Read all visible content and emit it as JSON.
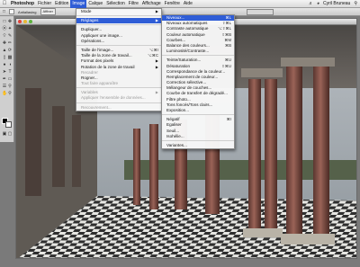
{
  "menubar": {
    "apple": "",
    "items": [
      "Photoshop",
      "Fichier",
      "Edition",
      "Image",
      "Calque",
      "Sélection",
      "Filtre",
      "Affichage",
      "Fenêtre",
      "Aide"
    ],
    "active_index": 3,
    "right_user": "Cyril Bruneau"
  },
  "optbar": {
    "checkbox_label": "Antialiasing",
    "button_label": "Affiner"
  },
  "image_menu": [
    {
      "label": "Mode",
      "sc": "",
      "sub": true,
      "dis": false,
      "sep_after": true
    },
    {
      "label": "Réglages",
      "sc": "",
      "sub": true,
      "dis": false,
      "hl": true,
      "sep_after": true
    },
    {
      "label": "Dupliquer...",
      "sc": "",
      "dis": false
    },
    {
      "label": "Appliquer une image...",
      "sc": "",
      "dis": false
    },
    {
      "label": "Opérations...",
      "sc": "",
      "dis": false,
      "sep_after": true
    },
    {
      "label": "Taille de l'image...",
      "sc": "⌥⌘I",
      "dis": false
    },
    {
      "label": "Taille de la zone de travail...",
      "sc": "⌥⌘C",
      "dis": false
    },
    {
      "label": "Format des pixels",
      "sc": "",
      "sub": true,
      "dis": false
    },
    {
      "label": "Rotation de la zone de travail",
      "sc": "",
      "sub": true,
      "dis": false
    },
    {
      "label": "Recadrer",
      "sc": "",
      "dis": true
    },
    {
      "label": "Rogner...",
      "sc": "",
      "dis": false
    },
    {
      "label": "Tout faire apparaître",
      "sc": "",
      "dis": true,
      "sep_after": true
    },
    {
      "label": "Variables",
      "sc": "",
      "sub": true,
      "dis": true
    },
    {
      "label": "Appliquer l'ensemble de données...",
      "sc": "",
      "dis": true,
      "sep_after": true
    },
    {
      "label": "Recouvrement...",
      "sc": "",
      "dis": true
    }
  ],
  "adjust_menu": [
    {
      "label": "Niveaux...",
      "sc": "⌘L",
      "hl": true
    },
    {
      "label": "Niveaux automatiques",
      "sc": "⇧⌘L"
    },
    {
      "label": "Contraste automatique",
      "sc": "⌥⇧⌘L"
    },
    {
      "label": "Couleur automatique",
      "sc": "⇧⌘B"
    },
    {
      "label": "Courbes...",
      "sc": "⌘M"
    },
    {
      "label": "Balance des couleurs...",
      "sc": "⌘B"
    },
    {
      "label": "Luminosité/Contraste...",
      "sc": "",
      "sep_after": true
    },
    {
      "label": "Teinte/Saturation...",
      "sc": "⌘U"
    },
    {
      "label": "Désaturation",
      "sc": "⇧⌘U"
    },
    {
      "label": "Correspondance de la couleur...",
      "sc": ""
    },
    {
      "label": "Remplacement de couleur...",
      "sc": ""
    },
    {
      "label": "Correction sélective...",
      "sc": ""
    },
    {
      "label": "Mélangeur de couches...",
      "sc": ""
    },
    {
      "label": "Courbe de transfert de dégradé...",
      "sc": ""
    },
    {
      "label": "Filtre photo...",
      "sc": ""
    },
    {
      "label": "Tons foncés/Tons clairs...",
      "sc": ""
    },
    {
      "label": "Exposition...",
      "sc": "",
      "sep_after": true
    },
    {
      "label": "Négatif",
      "sc": "⌘I"
    },
    {
      "label": "Egaliser",
      "sc": ""
    },
    {
      "label": "Seuil...",
      "sc": ""
    },
    {
      "label": "Isohélie...",
      "sc": "",
      "sep_after": true
    },
    {
      "label": "Variantes...",
      "sc": ""
    }
  ],
  "colors": {
    "menu_highlight": "#2f5dd6",
    "foreground": "#000000",
    "background": "#ffffff"
  }
}
